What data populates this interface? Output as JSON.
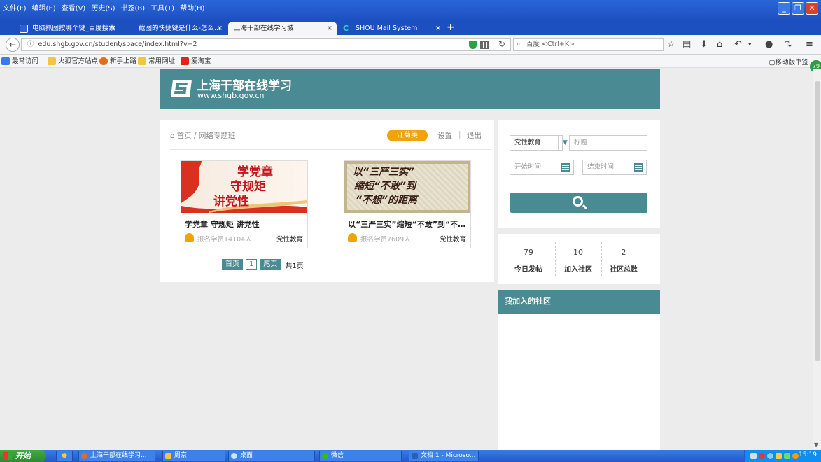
{
  "browser": {
    "menu": [
      "文件(F)",
      "编辑(E)",
      "查看(V)",
      "历史(S)",
      "书签(B)",
      "工具(T)",
      "帮助(H)"
    ],
    "tabs": [
      {
        "title": "电脑抓图按哪个键_百度搜索",
        "active": false
      },
      {
        "title": "截图的快捷键是什么-怎么…",
        "active": false
      },
      {
        "title": "上海干部在线学习城",
        "active": true
      },
      {
        "title": "SHOU Mail System",
        "active": false
      }
    ],
    "url": "edu.shgb.gov.cn/student/space/index.html?v=2",
    "search_placeholder": "百度 <Ctrl+K>",
    "bookmarks": [
      "最常访问",
      "火狐官方站点",
      "新手上路",
      "常用网址",
      "爱淘宝"
    ],
    "mobile_bookmarks": "移动版书签",
    "badge_count": "79"
  },
  "site": {
    "brand_name": "上海干部在线学习",
    "brand_url": "www.shgb.gov.cn"
  },
  "main": {
    "breadcrumb": "首页 / 网络专题班",
    "user_name": "江菊美",
    "settings_label": "设置",
    "separator": "|",
    "logout_label": "退出",
    "courses": [
      {
        "title": "学党章 守规矩 讲党性",
        "image_lines": [
          "学党章",
          "守规矩",
          "讲党性"
        ],
        "enrolled": "报名学员14104人",
        "category": "党性教育"
      },
      {
        "title": "以“三严三实”缩短“不敢”到“不…",
        "image_lines": [
          "以“三严三实”",
          "缩短“不敢”到",
          "“不想”的距离"
        ],
        "enrolled": "报名学员7609人",
        "category": "党性教育"
      }
    ],
    "pager": {
      "first": "首页",
      "current": "1",
      "last": "尾页",
      "total": "共1页"
    }
  },
  "search_panel": {
    "category_value": "党性教育",
    "title_placeholder": "标题",
    "start_placeholder": "开始时间",
    "end_placeholder": "结束时间"
  },
  "stats": [
    {
      "value": "79",
      "label": "今日发帖"
    },
    {
      "value": "10",
      "label": "加入社区"
    },
    {
      "value": "2",
      "label": "社区总数"
    }
  ],
  "community": {
    "heading": "我加入的社区"
  },
  "taskbar": {
    "start": "开始",
    "tasks": [
      "上海干部在线学习...",
      "周京",
      "桌面",
      "微信",
      "文档 1 - Microso..."
    ],
    "clock": "15:19"
  },
  "colors": {
    "accent": "#4a8a93",
    "badge": "#f0a30a"
  }
}
